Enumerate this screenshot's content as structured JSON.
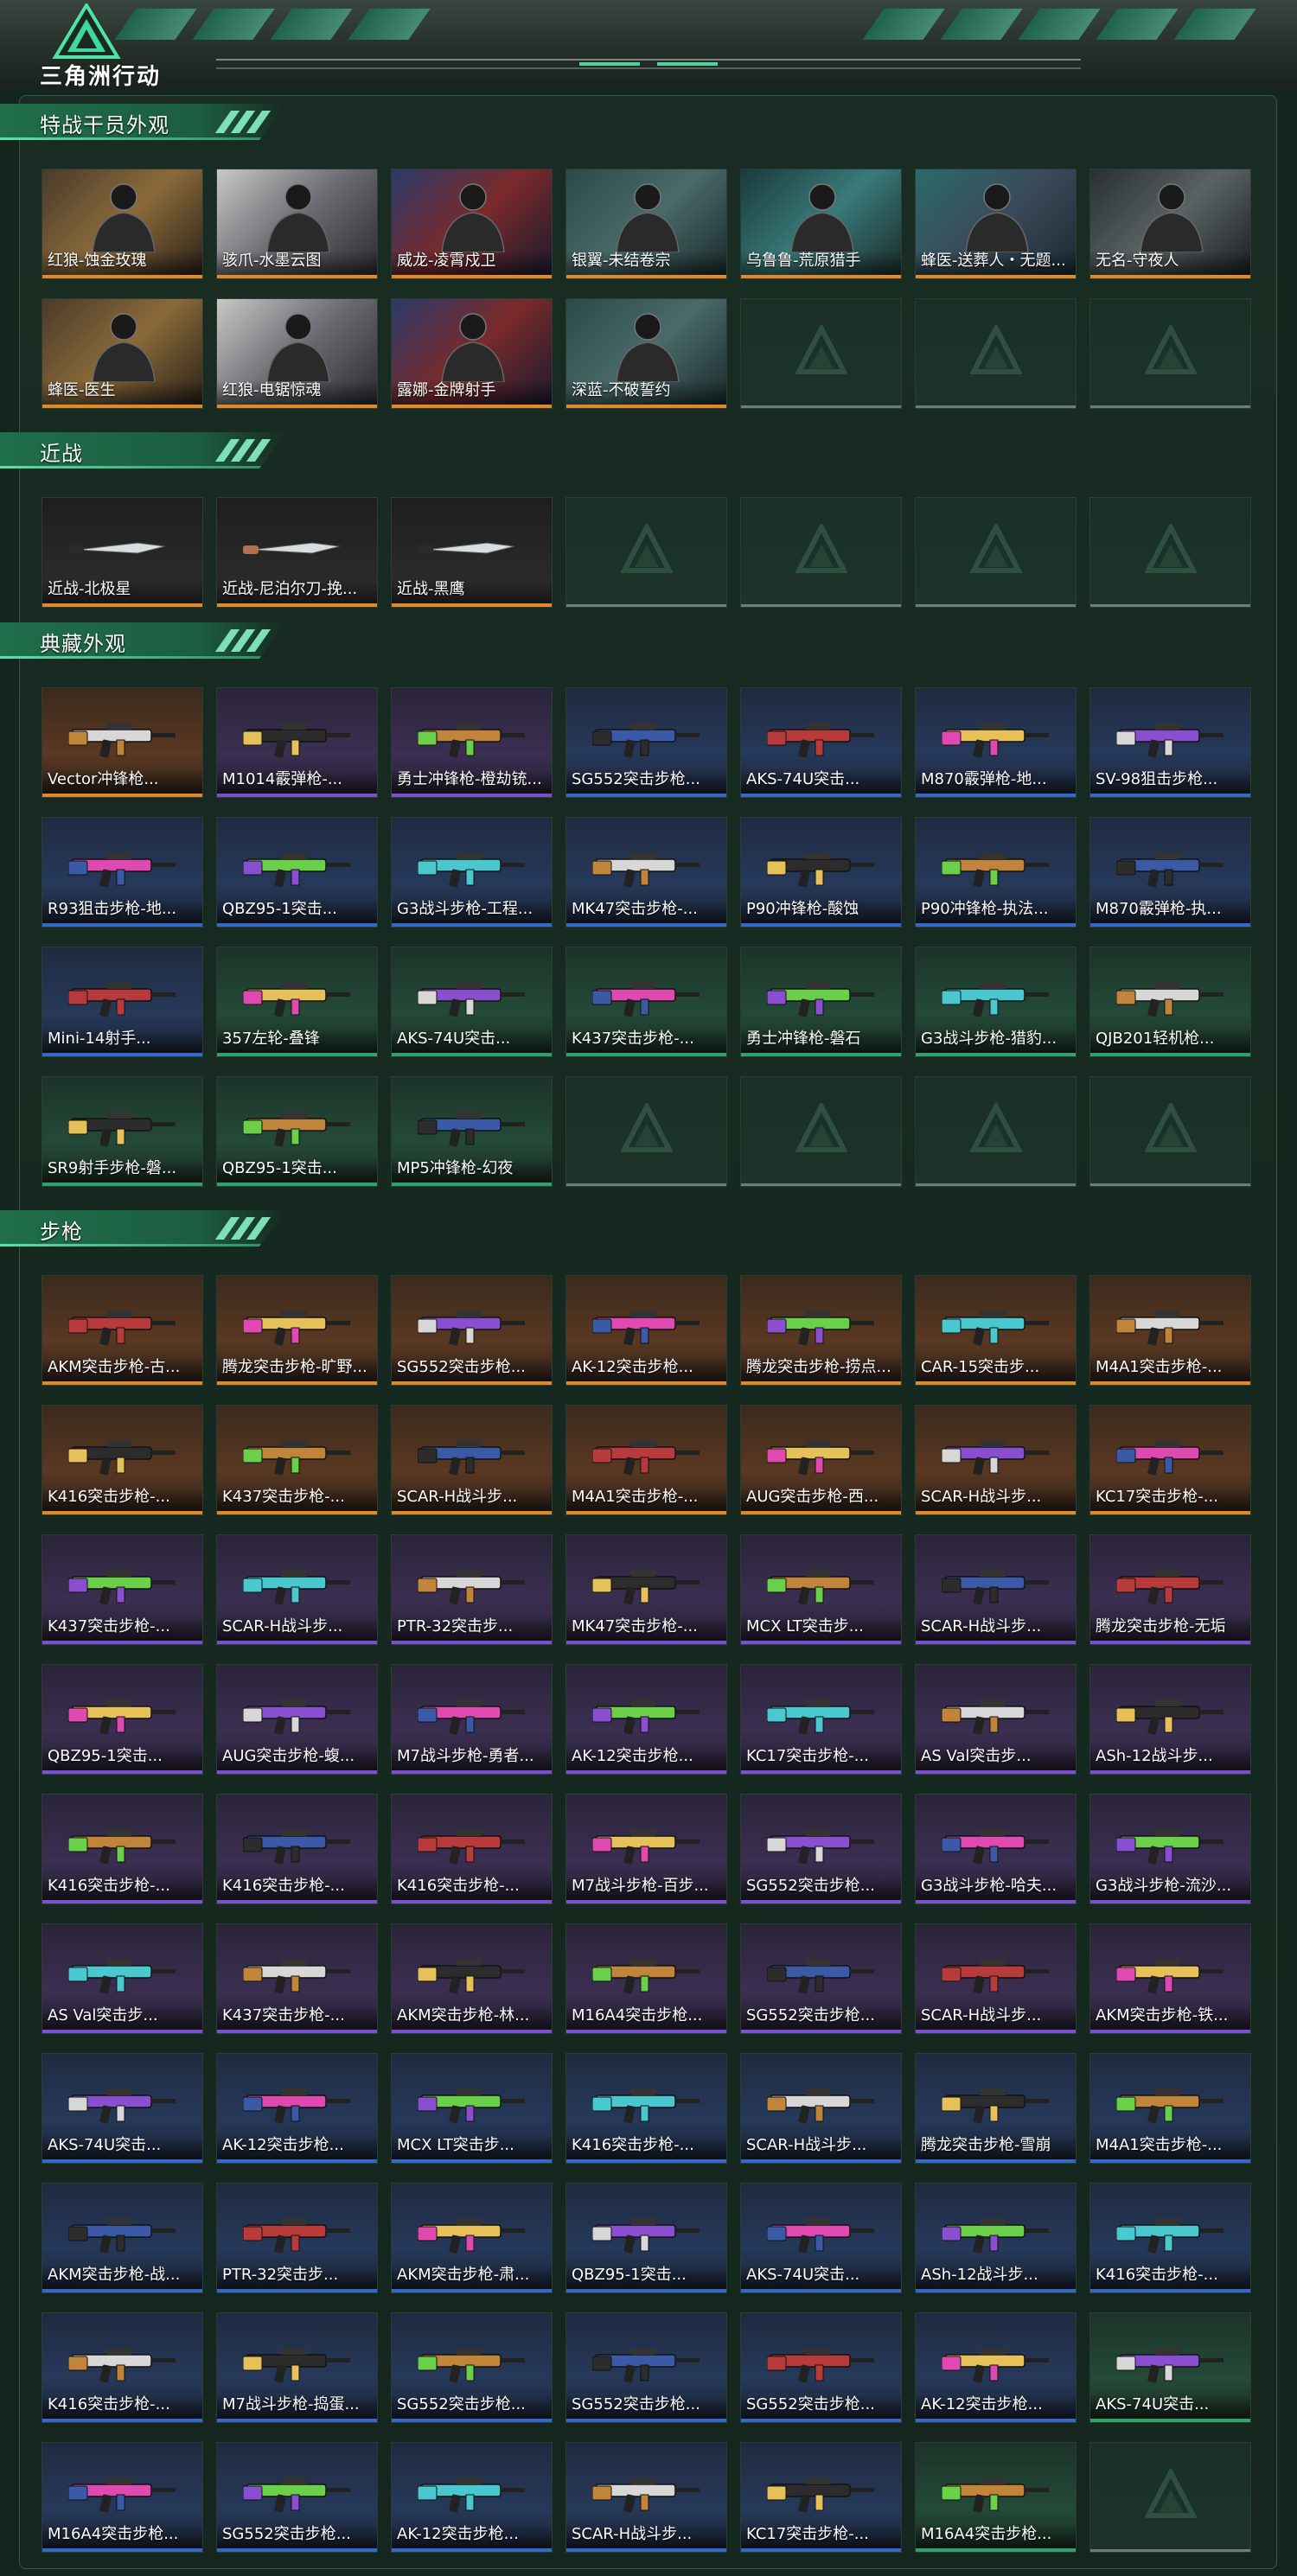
{
  "app": {
    "logo_text": "三角洲行动"
  },
  "colors": {
    "gold": "#e0892a",
    "red": "#c0392b",
    "purple": "#7a4fd0",
    "blue": "#3569c8",
    "green": "#2fa36b",
    "empty": "#6e7d75"
  },
  "sections": [
    {
      "title": "特战干员外观",
      "items": [
        {
          "label": "红狼-蚀金玫瑰",
          "rarity": "gold",
          "art": "operator"
        },
        {
          "label": "骇爪-水墨云图",
          "rarity": "gold",
          "art": "operator"
        },
        {
          "label": "威龙-凌霄戍卫",
          "rarity": "gold",
          "art": "operator"
        },
        {
          "label": "银翼-未结卷宗",
          "rarity": "gold",
          "art": "operator"
        },
        {
          "label": "乌鲁鲁-荒原猎手",
          "rarity": "gold",
          "art": "operator"
        },
        {
          "label": "蜂医-送葬人・无题...",
          "rarity": "gold",
          "art": "operator"
        },
        {
          "label": "无名-守夜人",
          "rarity": "gold",
          "art": "operator"
        },
        {
          "label": "蜂医-医生",
          "rarity": "gold",
          "art": "operator"
        },
        {
          "label": "红狼-电锯惊魂",
          "rarity": "gold",
          "art": "operator"
        },
        {
          "label": "露娜-金牌射手",
          "rarity": "gold",
          "art": "operator"
        },
        {
          "label": "深蓝-不破誓约",
          "rarity": "gold",
          "art": "operator"
        }
      ],
      "empty_slots": 3
    },
    {
      "title": "近战",
      "items": [
        {
          "label": "近战-北极星",
          "rarity": "gold",
          "art": "knife"
        },
        {
          "label": "近战-尼泊尔刀-挽...",
          "rarity": "gold",
          "art": "knife"
        },
        {
          "label": "近战-黑鹰",
          "rarity": "gold",
          "art": "knife"
        }
      ],
      "empty_slots": 4
    },
    {
      "title": "典藏外观",
      "items": [
        {
          "label": "Vector冲锋枪...",
          "rarity": "gold",
          "art": "gun"
        },
        {
          "label": "M1014霰弹枪-...",
          "rarity": "purple",
          "art": "gun"
        },
        {
          "label": "勇士冲锋枪-橙劫铳...",
          "rarity": "purple",
          "art": "gun"
        },
        {
          "label": "SG552突击步枪...",
          "rarity": "blue",
          "art": "gun"
        },
        {
          "label": "AKS-74U突击...",
          "rarity": "blue",
          "art": "gun"
        },
        {
          "label": "M870霰弹枪-地...",
          "rarity": "blue",
          "art": "gun"
        },
        {
          "label": "SV-98狙击步枪...",
          "rarity": "blue",
          "art": "gun"
        },
        {
          "label": "R93狙击步枪-地...",
          "rarity": "blue",
          "art": "gun"
        },
        {
          "label": "QBZ95-1突击...",
          "rarity": "blue",
          "art": "gun"
        },
        {
          "label": "G3战斗步枪-工程...",
          "rarity": "blue",
          "art": "gun"
        },
        {
          "label": "MK47突击步枪-...",
          "rarity": "blue",
          "art": "gun"
        },
        {
          "label": "P90冲锋枪-酸蚀",
          "rarity": "blue",
          "art": "gun"
        },
        {
          "label": "P90冲锋枪-执法...",
          "rarity": "blue",
          "art": "gun"
        },
        {
          "label": "M870霰弹枪-执...",
          "rarity": "blue",
          "art": "gun"
        },
        {
          "label": "Mini-14射手...",
          "rarity": "blue",
          "art": "gun"
        },
        {
          "label": "357左轮-叠锋",
          "rarity": "green",
          "art": "gun"
        },
        {
          "label": "AKS-74U突击...",
          "rarity": "green",
          "art": "gun"
        },
        {
          "label": "K437突击步枪-...",
          "rarity": "green",
          "art": "gun"
        },
        {
          "label": "勇士冲锋枪-磐石",
          "rarity": "green",
          "art": "gun"
        },
        {
          "label": "G3战斗步枪-猎豹...",
          "rarity": "green",
          "art": "gun"
        },
        {
          "label": "QJB201轻机枪...",
          "rarity": "green",
          "art": "gun"
        },
        {
          "label": "SR9射手步枪-磐...",
          "rarity": "green",
          "art": "gun"
        },
        {
          "label": "QBZ95-1突击...",
          "rarity": "green",
          "art": "gun"
        },
        {
          "label": "MP5冲锋枪-幻夜",
          "rarity": "green",
          "art": "gun"
        }
      ],
      "empty_slots": 4
    },
    {
      "title": "步枪",
      "items": [
        {
          "label": "AKM突击步枪-古...",
          "rarity": "gold",
          "art": "gun"
        },
        {
          "label": "腾龙突击步枪-旷野...",
          "rarity": "gold",
          "art": "gun"
        },
        {
          "label": "SG552突击步枪...",
          "rarity": "gold",
          "art": "gun"
        },
        {
          "label": "AK-12突击步枪...",
          "rarity": "gold",
          "art": "gun"
        },
        {
          "label": "腾龙突击步枪-捞点...",
          "rarity": "gold",
          "art": "gun"
        },
        {
          "label": "CAR-15突击步...",
          "rarity": "gold",
          "art": "gun"
        },
        {
          "label": "M4A1突击步枪-...",
          "rarity": "gold",
          "art": "gun"
        },
        {
          "label": "K416突击步枪-...",
          "rarity": "gold",
          "art": "gun"
        },
        {
          "label": "K437突击步枪-...",
          "rarity": "gold",
          "art": "gun"
        },
        {
          "label": "SCAR-H战斗步...",
          "rarity": "gold",
          "art": "gun"
        },
        {
          "label": "M4A1突击步枪-...",
          "rarity": "gold",
          "art": "gun"
        },
        {
          "label": "AUG突击步枪-西...",
          "rarity": "gold",
          "art": "gun"
        },
        {
          "label": "SCAR-H战斗步...",
          "rarity": "gold",
          "art": "gun"
        },
        {
          "label": "KC17突击步枪-...",
          "rarity": "gold",
          "art": "gun"
        },
        {
          "label": "K437突击步枪-...",
          "rarity": "purple",
          "art": "gun"
        },
        {
          "label": "SCAR-H战斗步...",
          "rarity": "purple",
          "art": "gun"
        },
        {
          "label": "PTR-32突击步...",
          "rarity": "purple",
          "art": "gun"
        },
        {
          "label": "MK47突击步枪-...",
          "rarity": "purple",
          "art": "gun"
        },
        {
          "label": "MCX LT突击步...",
          "rarity": "purple",
          "art": "gun"
        },
        {
          "label": "SCAR-H战斗步...",
          "rarity": "purple",
          "art": "gun"
        },
        {
          "label": "腾龙突击步枪-无垢",
          "rarity": "purple",
          "art": "gun"
        },
        {
          "label": "QBZ95-1突击...",
          "rarity": "purple",
          "art": "gun"
        },
        {
          "label": "AUG突击步枪-蝮...",
          "rarity": "purple",
          "art": "gun"
        },
        {
          "label": "M7战斗步枪-勇者...",
          "rarity": "purple",
          "art": "gun"
        },
        {
          "label": "AK-12突击步枪...",
          "rarity": "purple",
          "art": "gun"
        },
        {
          "label": "KC17突击步枪-...",
          "rarity": "purple",
          "art": "gun"
        },
        {
          "label": "AS Val突击步...",
          "rarity": "purple",
          "art": "gun"
        },
        {
          "label": "ASh-12战斗步...",
          "rarity": "purple",
          "art": "gun"
        },
        {
          "label": "K416突击步枪-...",
          "rarity": "purple",
          "art": "gun"
        },
        {
          "label": "K416突击步枪-...",
          "rarity": "purple",
          "art": "gun"
        },
        {
          "label": "K416突击步枪-...",
          "rarity": "purple",
          "art": "gun"
        },
        {
          "label": "M7战斗步枪-百步...",
          "rarity": "purple",
          "art": "gun"
        },
        {
          "label": "SG552突击步枪...",
          "rarity": "purple",
          "art": "gun"
        },
        {
          "label": "G3战斗步枪-哈夫...",
          "rarity": "purple",
          "art": "gun"
        },
        {
          "label": "G3战斗步枪-流沙...",
          "rarity": "purple",
          "art": "gun"
        },
        {
          "label": "AS Val突击步...",
          "rarity": "purple",
          "art": "gun"
        },
        {
          "label": "K437突击步枪-...",
          "rarity": "purple",
          "art": "gun"
        },
        {
          "label": "AKM突击步枪-林...",
          "rarity": "purple",
          "art": "gun"
        },
        {
          "label": "M16A4突击步枪...",
          "rarity": "purple",
          "art": "gun"
        },
        {
          "label": "SG552突击步枪...",
          "rarity": "purple",
          "art": "gun"
        },
        {
          "label": "SCAR-H战斗步...",
          "rarity": "purple",
          "art": "gun"
        },
        {
          "label": "AKM突击步枪-铁...",
          "rarity": "purple",
          "art": "gun"
        },
        {
          "label": "AKS-74U突击...",
          "rarity": "blue",
          "art": "gun"
        },
        {
          "label": "AK-12突击步枪...",
          "rarity": "blue",
          "art": "gun"
        },
        {
          "label": "MCX LT突击步...",
          "rarity": "blue",
          "art": "gun"
        },
        {
          "label": "K416突击步枪-...",
          "rarity": "blue",
          "art": "gun"
        },
        {
          "label": "SCAR-H战斗步...",
          "rarity": "blue",
          "art": "gun"
        },
        {
          "label": "腾龙突击步枪-雪崩",
          "rarity": "blue",
          "art": "gun"
        },
        {
          "label": "M4A1突击步枪-...",
          "rarity": "blue",
          "art": "gun"
        },
        {
          "label": "AKM突击步枪-战...",
          "rarity": "blue",
          "art": "gun"
        },
        {
          "label": "PTR-32突击步...",
          "rarity": "blue",
          "art": "gun"
        },
        {
          "label": "AKM突击步枪-肃...",
          "rarity": "blue",
          "art": "gun"
        },
        {
          "label": "QBZ95-1突击...",
          "rarity": "blue",
          "art": "gun"
        },
        {
          "label": "AKS-74U突击...",
          "rarity": "blue",
          "art": "gun"
        },
        {
          "label": "ASh-12战斗步...",
          "rarity": "blue",
          "art": "gun"
        },
        {
          "label": "K416突击步枪-...",
          "rarity": "blue",
          "art": "gun"
        },
        {
          "label": "K416突击步枪-...",
          "rarity": "blue",
          "art": "gun"
        },
        {
          "label": "M7战斗步枪-捣蛋...",
          "rarity": "blue",
          "art": "gun"
        },
        {
          "label": "SG552突击步枪...",
          "rarity": "blue",
          "art": "gun"
        },
        {
          "label": "SG552突击步枪...",
          "rarity": "blue",
          "art": "gun"
        },
        {
          "label": "SG552突击步枪...",
          "rarity": "blue",
          "art": "gun"
        },
        {
          "label": "AK-12突击步枪...",
          "rarity": "blue",
          "art": "gun"
        },
        {
          "label": "AKS-74U突击...",
          "rarity": "green",
          "art": "gun"
        },
        {
          "label": "M16A4突击步枪...",
          "rarity": "blue",
          "art": "gun"
        },
        {
          "label": "SG552突击步枪...",
          "rarity": "blue",
          "art": "gun"
        },
        {
          "label": "AK-12突击步枪...",
          "rarity": "blue",
          "art": "gun"
        },
        {
          "label": "SCAR-H战斗步...",
          "rarity": "blue",
          "art": "gun"
        },
        {
          "label": "KC17突击步枪-...",
          "rarity": "blue",
          "art": "gun"
        },
        {
          "label": "M16A4突击步枪...",
          "rarity": "green",
          "art": "gun"
        }
      ],
      "empty_slots": 1
    }
  ]
}
